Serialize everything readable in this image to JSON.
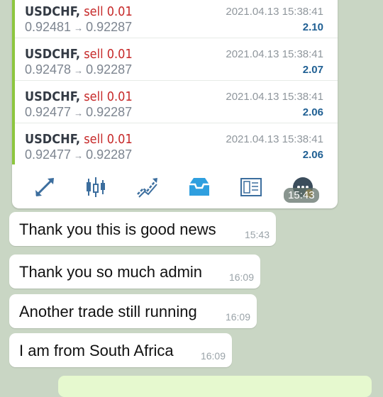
{
  "trades": [
    {
      "symbol": "USDCHF,",
      "side": "sell 0.01",
      "open_price": "0.92481",
      "close_price": "0.92287",
      "arrow": "→",
      "time": "2021.04.13 15:38:41",
      "profit": "2.10"
    },
    {
      "symbol": "USDCHF,",
      "side": "sell 0.01",
      "open_price": "0.92478",
      "close_price": "0.92287",
      "arrow": "→",
      "time": "2021.04.13 15:38:41",
      "profit": "2.07"
    },
    {
      "symbol": "USDCHF,",
      "side": "sell 0.01",
      "open_price": "0.92477",
      "close_price": "0.92287",
      "arrow": "→",
      "time": "2021.04.13 15:38:41",
      "profit": "2.06"
    },
    {
      "symbol": "USDCHF,",
      "side": "sell 0.01",
      "open_price": "0.92477",
      "close_price": "0.92287",
      "arrow": "→",
      "time": "2021.04.13 15:38:41",
      "profit": "2.06"
    }
  ],
  "toolbar_icons": [
    "quotes-icon",
    "chart-icon",
    "trade-icon",
    "history-inbox-icon",
    "news-icon",
    "chat-icon"
  ],
  "image_time": "15:43",
  "messages": [
    {
      "text": "Thank you this is good news",
      "time": "15:43"
    },
    {
      "text": "Thank you so much admin",
      "time": "16:09"
    },
    {
      "text": "Another trade still running",
      "time": "16:09"
    },
    {
      "text": "I am from South Africa",
      "time": "16:09"
    }
  ],
  "colors": {
    "accent": "#8dc63f",
    "sell": "#c62828",
    "profit": "#1f5f93",
    "chat_bg": "#c9d6c4"
  }
}
